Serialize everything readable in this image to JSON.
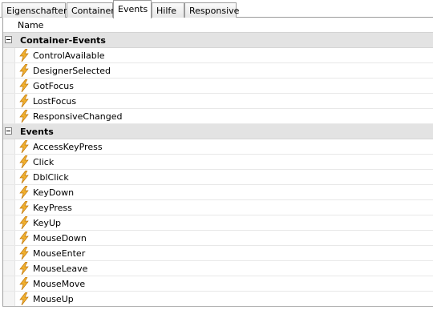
{
  "tabs": [
    {
      "label": "Eigenschaften",
      "active": false
    },
    {
      "label": "Container",
      "active": false
    },
    {
      "label": "Events",
      "active": true
    },
    {
      "label": "Hilfe",
      "active": false
    },
    {
      "label": "Responsive",
      "active": false
    }
  ],
  "grid": {
    "column_header": "Name",
    "categories": [
      {
        "label": "Container-Events",
        "expanded": true,
        "items": [
          "ControlAvailable",
          "DesignerSelected",
          "GotFocus",
          "LostFocus",
          "ResponsiveChanged"
        ]
      },
      {
        "label": "Events",
        "expanded": true,
        "items": [
          "AccessKeyPress",
          "Click",
          "DblClick",
          "KeyDown",
          "KeyPress",
          "KeyUp",
          "MouseDown",
          "MouseEnter",
          "MouseLeave",
          "MouseMove",
          "MouseUp"
        ]
      }
    ]
  },
  "icons": {
    "event": "lightning-bolt-icon",
    "collapse": "collapse-minus-icon"
  },
  "colors": {
    "category_bg": "#e3e3e3",
    "bolt": "#e8a11c"
  }
}
